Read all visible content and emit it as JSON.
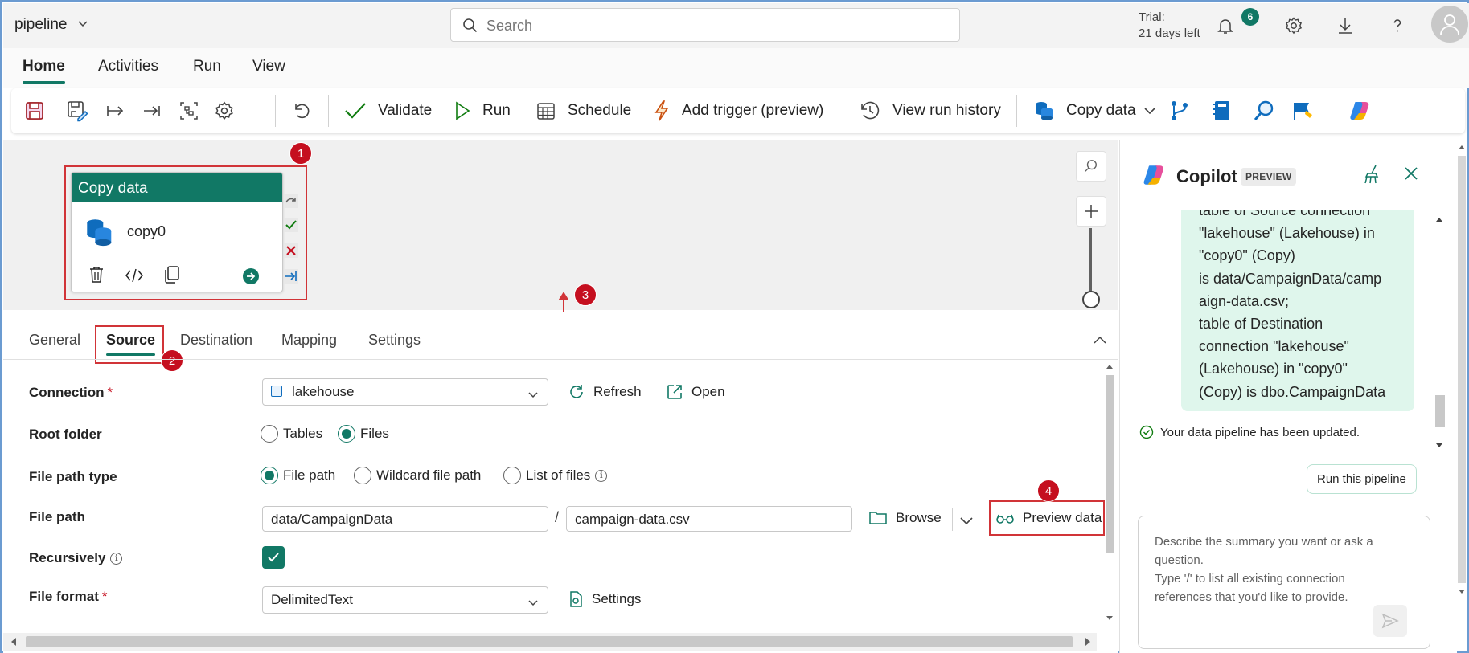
{
  "app": {
    "title": "pipeline"
  },
  "search": {
    "placeholder": "Search"
  },
  "trial": {
    "line1": "Trial:",
    "line2": "21 days left"
  },
  "notifications": {
    "count": "6"
  },
  "menu": {
    "tabs": [
      "Home",
      "Activities",
      "Run",
      "View"
    ],
    "active": "Home"
  },
  "toolbar": {
    "validate": "Validate",
    "run": "Run",
    "schedule": "Schedule",
    "add_trigger": "Add trigger (preview)",
    "view_run_history": "View run history",
    "copy_data": "Copy data"
  },
  "activity": {
    "type": "Copy data",
    "name": "copy0"
  },
  "badges": {
    "b1": "1",
    "b2": "2",
    "b3": "3",
    "b4": "4"
  },
  "props": {
    "tabs": [
      "General",
      "Source",
      "Destination",
      "Mapping",
      "Settings"
    ],
    "active_tab": "Source",
    "connection": {
      "label": "Connection",
      "required": "*",
      "value": "lakehouse",
      "refresh": "Refresh",
      "open": "Open"
    },
    "root_folder": {
      "label": "Root folder",
      "options": [
        "Tables",
        "Files"
      ],
      "selected": "Files"
    },
    "file_path_type": {
      "label": "File path type",
      "options": [
        "File path",
        "Wildcard file path",
        "List of files"
      ],
      "selected": "File path"
    },
    "file_path": {
      "label": "File path",
      "folder": "data/CampaignData",
      "separator": "/",
      "file": "campaign-data.csv",
      "browse": "Browse",
      "preview": "Preview data"
    },
    "recursively": {
      "label": "Recursively",
      "checked": true
    },
    "file_format": {
      "label": "File format",
      "required": "*",
      "value": "DelimitedText",
      "settings": "Settings"
    }
  },
  "copilot": {
    "title": "Copilot",
    "badge": "PREVIEW",
    "message_lines": [
      "table of Source connection",
      "\"lakehouse\" (Lakehouse) in",
      "\"copy0\" (Copy)",
      "is data/CampaignData/camp",
      "aign-data.csv;",
      "table of Destination",
      "connection \"lakehouse\"",
      "(Lakehouse) in \"copy0\"",
      "(Copy) is dbo.CampaignData"
    ],
    "status": "Your data pipeline has been updated.",
    "run_button": "Run this pipeline",
    "input_placeholder_1": "Describe the summary you want or ask a question.",
    "input_placeholder_2": "Type '/' to list all existing connection references that you'd like to provide."
  },
  "colors": {
    "accent": "#117865",
    "highlight": "#d13438",
    "badge": "#c50f1f",
    "copilot_bubble": "#dff6ec"
  }
}
